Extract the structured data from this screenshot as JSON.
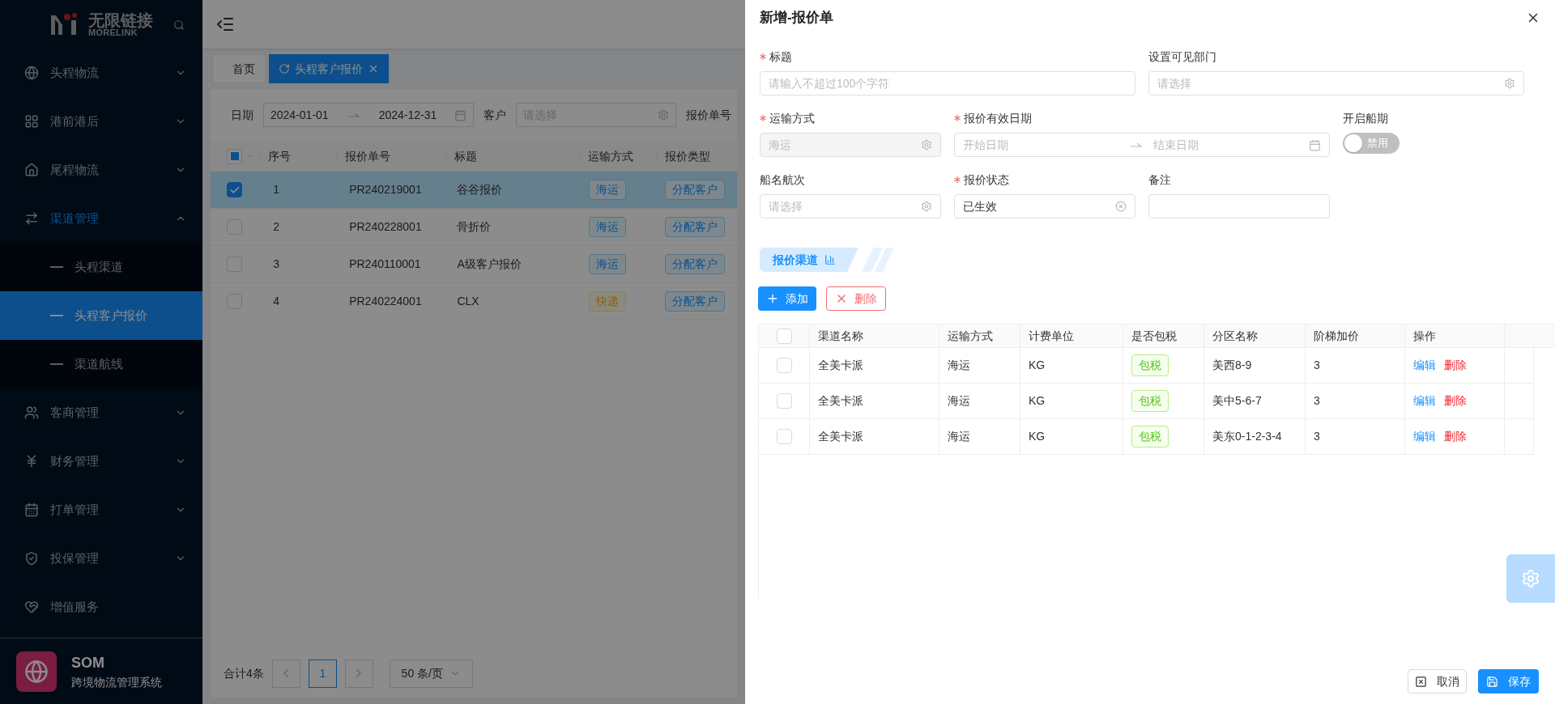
{
  "sidebar": {
    "logo_text": "无限链接",
    "logo_subtext": "MORELINK",
    "menu": [
      {
        "label": "头程物流",
        "kind": "group",
        "expanded": false
      },
      {
        "label": "港前港后",
        "kind": "group",
        "expanded": false
      },
      {
        "label": "尾程物流",
        "kind": "group",
        "expanded": false
      },
      {
        "label": "渠道管理",
        "kind": "group",
        "expanded": true,
        "children": [
          {
            "label": "头程渠道",
            "selected": false
          },
          {
            "label": "头程客户报价",
            "selected": true
          },
          {
            "label": "渠道航线",
            "selected": false
          }
        ]
      },
      {
        "label": "客商管理",
        "kind": "group",
        "expanded": false
      },
      {
        "label": "财务管理",
        "kind": "group",
        "expanded": false
      },
      {
        "label": "打单管理",
        "kind": "group",
        "expanded": false
      },
      {
        "label": "投保管理",
        "kind": "group",
        "expanded": false
      },
      {
        "label": "增值服务",
        "kind": "link"
      }
    ],
    "footer": {
      "title": "SOM",
      "subtitle": "跨境物流管理系统"
    }
  },
  "tabs": [
    {
      "label": "首页",
      "selected": false
    },
    {
      "label": "头程客户报价",
      "selected": true
    }
  ],
  "filters": {
    "date_label": "日期",
    "date_start": "2024-01-01",
    "date_end": "2024-12-31",
    "customer_label": "客户",
    "customer_placeholder": "请选择",
    "order_label": "报价单号"
  },
  "table": {
    "select_all": {
      "checked": false,
      "indeterminate": true
    },
    "columns": [
      "序号",
      "报价单号",
      "标题",
      "运输方式",
      "报价类型"
    ],
    "rows": [
      {
        "checked": true,
        "index": "1",
        "number": "PR240219001",
        "title": "谷谷报价",
        "transport": {
          "label": "海运",
          "kind": "sea"
        },
        "type": "分配客户"
      },
      {
        "checked": false,
        "index": "2",
        "number": "PR240228001",
        "title": "骨折价",
        "transport": {
          "label": "海运",
          "kind": "sea"
        },
        "type": "分配客户"
      },
      {
        "checked": false,
        "index": "3",
        "number": "PR240110001",
        "title": "A级客户报价",
        "transport": {
          "label": "海运",
          "kind": "sea"
        },
        "type": "分配客户"
      },
      {
        "checked": false,
        "index": "4",
        "number": "PR240224001",
        "title": "CLX",
        "transport": {
          "label": "快递",
          "kind": "express"
        },
        "type": "分配客户"
      }
    ]
  },
  "pagination": {
    "total": "合计4条",
    "pages": [
      {
        "label": "1",
        "selected": true
      }
    ],
    "page_size": "50 条/页"
  },
  "drawer": {
    "title": "新增-报价单",
    "fields": [
      {
        "kind": "text",
        "label": "标题",
        "required": true,
        "placeholder": "请输入不超过100个字符"
      },
      {
        "kind": "select",
        "label": "设置可见部门",
        "required": false,
        "placeholder": "请选择"
      },
      {
        "kind": "select",
        "label": "运输方式",
        "required": true,
        "value": "海运",
        "disabled": true
      },
      {
        "kind": "date_range",
        "label": "报价有效日期",
        "required": true,
        "start_placeholder": "开始日期",
        "end_placeholder": "结束日期"
      },
      {
        "kind": "switch",
        "label": "开启船期",
        "required": false,
        "on": false,
        "text": "禁用"
      },
      {
        "kind": "select",
        "label": "船名航次",
        "required": false,
        "placeholder": "请选择"
      },
      {
        "kind": "clearable",
        "label": "报价状态",
        "required": true,
        "value": "已生效"
      },
      {
        "kind": "text",
        "label": "备注",
        "required": false
      }
    ],
    "section": "报价渠道",
    "add_button": "添加",
    "delete_button": "删除",
    "channel_table": {
      "all_checked": false,
      "columns": [
        "渠道名称",
        "运输方式",
        "计费单位",
        "是否包税",
        "分区名称",
        "阶梯加价",
        "操作"
      ],
      "rows": [
        {
          "checked": false,
          "name": "全美卡派",
          "transport": "海运",
          "unit": "KG",
          "tax": "包税",
          "zone": "美西8-9",
          "markup": "3",
          "actions": [
            "编辑",
            "删除"
          ]
        },
        {
          "checked": false,
          "name": "全美卡派",
          "transport": "海运",
          "unit": "KG",
          "tax": "包税",
          "zone": "美中5-6-7",
          "markup": "3",
          "actions": [
            "编辑",
            "删除"
          ]
        },
        {
          "checked": false,
          "name": "全美卡派",
          "transport": "海运",
          "unit": "KG",
          "tax": "包税",
          "zone": "美东0-1-2-3-4",
          "markup": "3",
          "actions": [
            "编辑",
            "删除"
          ]
        }
      ]
    },
    "cancel_button": "取消",
    "save_button": "保存"
  }
}
